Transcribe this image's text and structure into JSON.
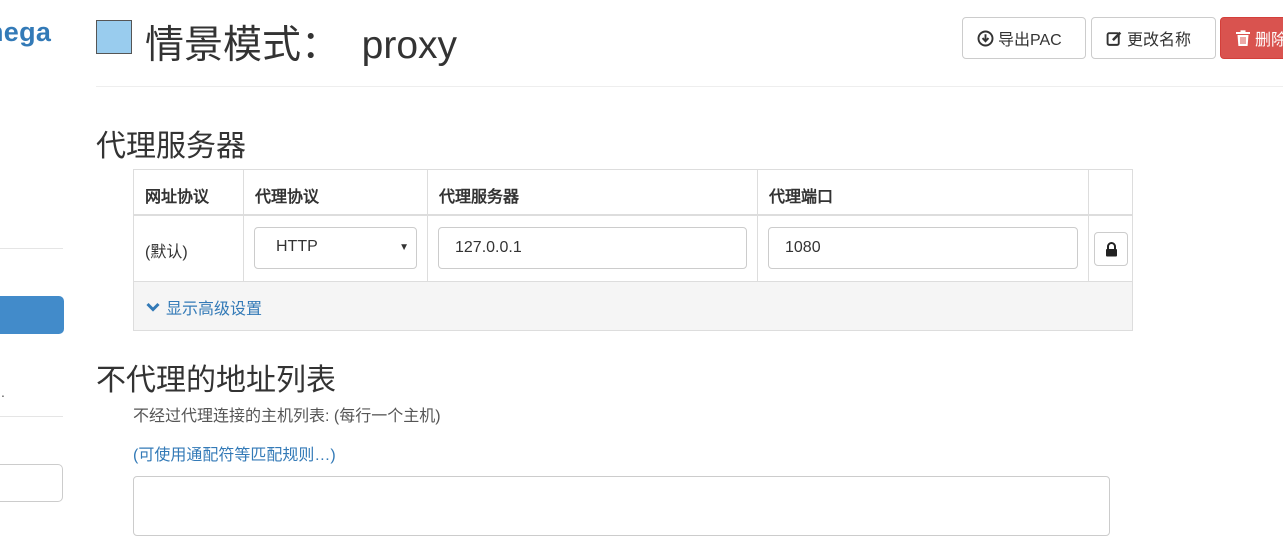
{
  "sidebar": {
    "brand_fragment": "nega",
    "dot_fragment": "."
  },
  "header": {
    "profile_color": "#99ccee",
    "title": "情景模式：  proxy",
    "export_pac_label": "导出PAC",
    "rename_label": "更改名称",
    "delete_label": "删除"
  },
  "proxy_section": {
    "heading": "代理服务器",
    "columns": [
      "网址协议",
      "代理协议",
      "代理服务器",
      "代理端口"
    ],
    "row": {
      "scheme": "(默认)",
      "protocol": "HTTP",
      "server": "127.0.0.1",
      "port": "1080"
    },
    "advanced_link": "显示高级设置"
  },
  "bypass_section": {
    "heading": "不代理的地址列表",
    "help_text": "不经过代理连接的主机列表: (每行一个主机)",
    "rules_link": "(可使用通配符等匹配规则…)"
  },
  "colors": {
    "accent": "#337ab7",
    "danger": "#d9534f",
    "sidebar_active": "#428bca"
  }
}
